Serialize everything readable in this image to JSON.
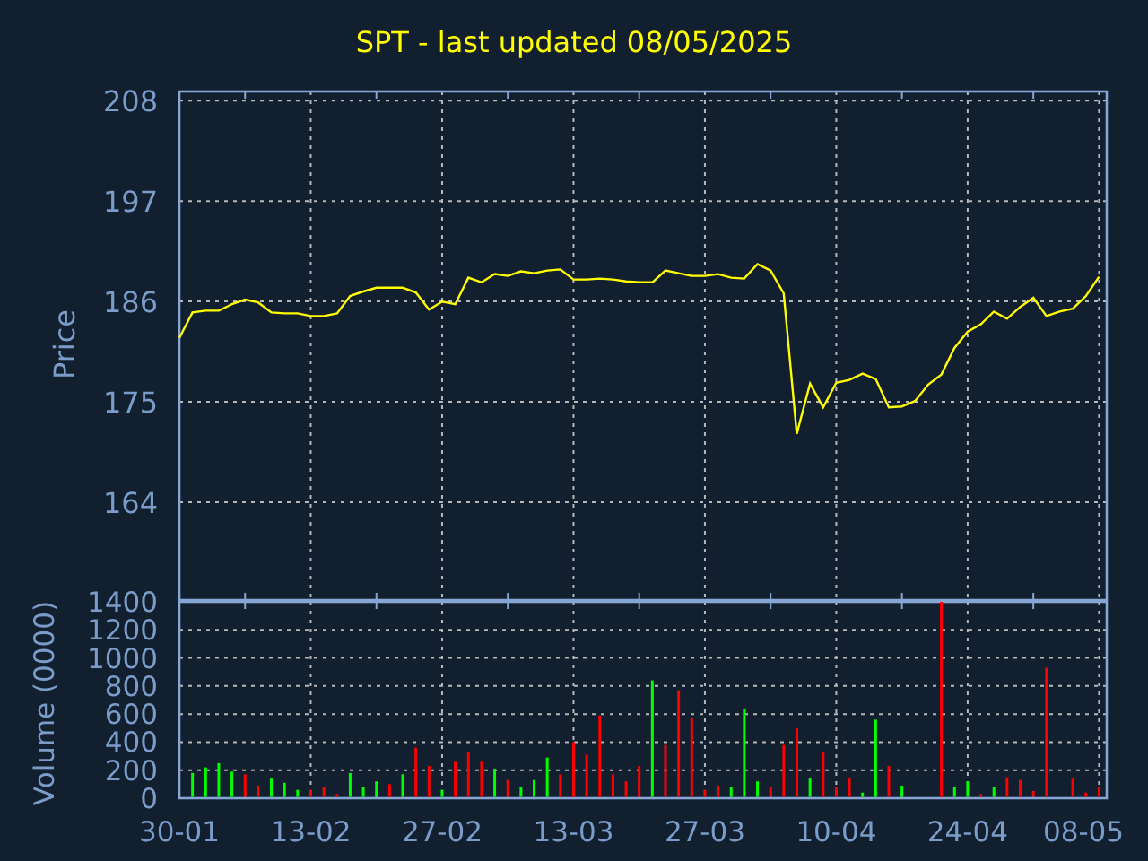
{
  "title": "SPT - last updated 08/05/2025",
  "price_chart": {
    "chart_data": {
      "type": "line",
      "ylabel": "Price",
      "categories": [
        null,
        null,
        null,
        null,
        null,
        null,
        null,
        null,
        null,
        null,
        null,
        null,
        null,
        null,
        null,
        null,
        null,
        null,
        null,
        null,
        null,
        null,
        null,
        null,
        null,
        null,
        null,
        null,
        null,
        null,
        null,
        null,
        null,
        null,
        null,
        null,
        null,
        null,
        null,
        null,
        null,
        null,
        null,
        null,
        null,
        null,
        null,
        null,
        null,
        null,
        null,
        null,
        null,
        null,
        null,
        null,
        null,
        null,
        null,
        null,
        null,
        null,
        null,
        null,
        null,
        null,
        null,
        null,
        null,
        null,
        null
      ],
      "series": [
        {
          "color": "#ffff00",
          "values": [
            182,
            184.8,
            185,
            185,
            185.7,
            186.2,
            185.9,
            184.8,
            184.7,
            184.7,
            184.4,
            184.4,
            184.7,
            186.6,
            187.1,
            187.5,
            187.5,
            187.5,
            187,
            185.1,
            186,
            185.7,
            188.6,
            188.1,
            189,
            188.8,
            189.3,
            189.1,
            189.4,
            189.5,
            188.4,
            188.4,
            188.5,
            188.4,
            188.2,
            188.1,
            188.1,
            189.4,
            189.1,
            188.8,
            188.8,
            189,
            188.6,
            188.5,
            190.1,
            189.4,
            186.9,
            171.5,
            177,
            174.4,
            177.1,
            177.4,
            178.1,
            177.5,
            174.4,
            174.5,
            175.1,
            176.9,
            178,
            180.9,
            182.7,
            183.5,
            184.9,
            184.1,
            185.4,
            186.4,
            184.4,
            184.9,
            185.2,
            186.6,
            188.7
          ]
        }
      ],
      "ylim": [
        153.2,
        209
      ],
      "grid": true,
      "yticks": [
        164,
        175,
        186,
        197,
        208
      ]
    }
  },
  "volume_chart": {
    "chart_data": {
      "type": "bar",
      "ylabel": "Volume (0000)",
      "categories": [
        "30-01",
        null,
        null,
        null,
        null,
        null,
        null,
        null,
        null,
        null,
        "13-02",
        null,
        null,
        null,
        null,
        null,
        null,
        null,
        null,
        null,
        "27-02",
        null,
        null,
        null,
        null,
        null,
        null,
        null,
        null,
        null,
        "13-03",
        null,
        null,
        null,
        null,
        null,
        null,
        null,
        null,
        null,
        "27-03",
        null,
        null,
        null,
        null,
        null,
        null,
        null,
        null,
        null,
        "10-04",
        null,
        null,
        null,
        null,
        null,
        null,
        null,
        null,
        null,
        "24-04",
        null,
        null,
        null,
        null,
        null,
        null,
        null,
        null,
        null,
        "08-05"
      ],
      "series": [
        {
          "color": "#00ff00",
          "values": [
            null,
            180,
            220,
            250,
            190,
            null,
            null,
            140,
            110,
            60,
            null,
            null,
            null,
            180,
            80,
            120,
            null,
            170,
            null,
            null,
            60,
            null,
            null,
            null,
            210,
            null,
            80,
            130,
            290,
            null,
            null,
            null,
            null,
            null,
            null,
            null,
            840,
            null,
            null,
            null,
            null,
            null,
            80,
            640,
            120,
            null,
            null,
            null,
            140,
            null,
            null,
            null,
            40,
            560,
            null,
            90,
            null,
            null,
            null,
            80,
            120,
            null,
            80,
            null,
            null,
            null,
            null,
            null,
            null,
            null,
            null
          ]
        },
        {
          "color": "#ff0000",
          "values": [
            null,
            null,
            null,
            null,
            null,
            170,
            90,
            null,
            null,
            null,
            60,
            80,
            30,
            null,
            null,
            null,
            100,
            null,
            360,
            230,
            null,
            260,
            330,
            260,
            null,
            130,
            null,
            null,
            null,
            170,
            400,
            310,
            590,
            170,
            120,
            230,
            null,
            380,
            770,
            570,
            60,
            90,
            null,
            null,
            null,
            80,
            380,
            500,
            null,
            330,
            80,
            140,
            null,
            null,
            230,
            null,
            null,
            null,
            1400,
            null,
            null,
            30,
            null,
            150,
            130,
            50,
            930,
            null,
            140,
            40,
            80
          ]
        }
      ],
      "ylim": [
        0,
        1400
      ],
      "grid": true,
      "yticks": [
        0,
        200,
        400,
        600,
        800,
        1000,
        1200,
        1400
      ]
    }
  }
}
